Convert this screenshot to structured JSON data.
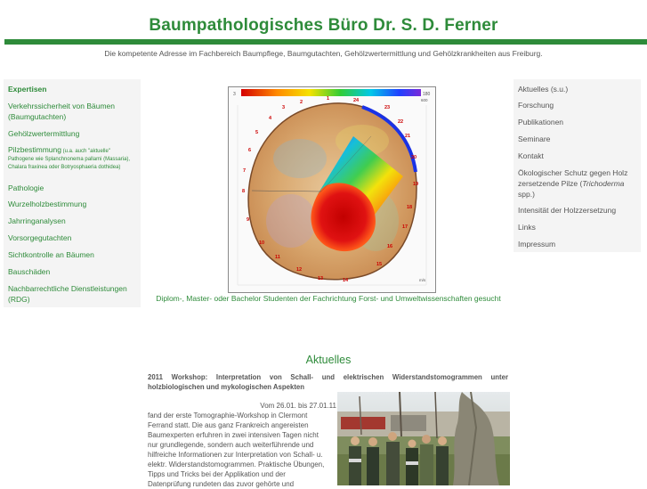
{
  "header": {
    "title": "Baumpathologisches Büro Dr. S. D. Ferner",
    "tagline": "Die kompetente Adresse im Fachbereich Baumpflege, Baumgutachten, Gehölzwertermittlung und Gehölzkrankheiten aus Freiburg."
  },
  "left_nav": {
    "expertisen": "Expertisen",
    "verkehr_1": "Verkehrssicherheit von Bäumen",
    "verkehr_2": "(Baumgutachten)",
    "gehoelz": "Gehölzwertermittlung",
    "pilz_main": "Pilzbestimmung",
    "pilz_sub1": " (u.a. auch \"aktuelle\"",
    "pilz_sub2": "Pathogene wie Splanchnonema pallami (Massaria),",
    "pilz_sub3": "Chalara fraxinea oder Botryosphaeria dothidea)",
    "pathologie": "Pathologie",
    "wurzel": "Wurzelholzbestimmung",
    "jahrring": "Jahrringanalysen",
    "vorsorge": "Vorsorgegutachten",
    "sicht": "Sichtkontrolle an Bäumen",
    "bau": "Bauschäden",
    "nachbar_1": "Nachbarrechtliche Dienstleistungen",
    "nachbar_2": "(RDG)"
  },
  "right_nav": {
    "aktuelles": "Aktuelles (s.u.)",
    "forschung": "Forschung",
    "publikationen": "Publikationen",
    "seminare": "Seminare",
    "kontakt": "Kontakt",
    "oeko_1": "Ökologischer Schutz gegen Holz",
    "oeko_2": "zersetzende Pilze (",
    "oeko_italic": "Trichoderma",
    "oeko_3": "spp.)",
    "intensitaet": "Intensität der Holzzersetzung",
    "links": "Links",
    "impressum": "Impressum"
  },
  "tomogram": {
    "numbers": [
      "1",
      "2",
      "3",
      "4",
      "5",
      "6",
      "7",
      "8",
      "9",
      "10",
      "11",
      "12",
      "13",
      "14",
      "15",
      "16",
      "17",
      "18",
      "19",
      "20",
      "21",
      "22",
      "23",
      "24"
    ],
    "scale_left": "3",
    "scale_right": "180",
    "corner_tr": "600",
    "corner_br": "m/s"
  },
  "main": {
    "caption": "Diplom-, Master- oder Bachelor Studenten der Fachrichtung Forst- und Umweltwissenschaften gesucht",
    "news_heading": "Aktuelles",
    "article_title": "2011 Workshop: Interpretation von Schall- und elektrischen Widerstandstomogrammen unter holzbiologischen und mykologischen Aspekten",
    "article_lines": [
      "Vom 26.01. bis 27.01.11",
      "fand der erste Tomographie-Workshop in Clermont",
      "Ferrand statt. Die aus ganz Frankreich angereisten",
      "Baumexperten erfuhren in zwei intensiven Tagen nicht",
      "nur grundlegende, sondern auch weiterführende und",
      "hilfreiche Informationen zur Interpretation von Schall- u.",
      "elektr. Widerstandstomogrammen. Praktische Übungen,",
      "Tipps und Tricks bei der Applikation und der",
      "Datenprüfung rundeten das zuvor gehörte und"
    ]
  },
  "colors": {
    "brand_green": "#2e8b3a",
    "nav_bg": "#f4f4f4"
  }
}
